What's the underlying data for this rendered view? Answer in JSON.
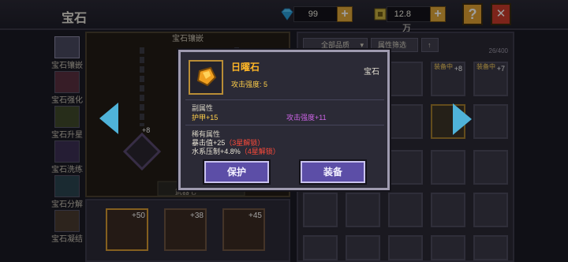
{
  "header": {
    "title": "宝石",
    "diamonds": "99",
    "gold": "12.8万",
    "help_label": "?",
    "close_label": "✕"
  },
  "sidenav": [
    {
      "label": "宝石镶嵌"
    },
    {
      "label": "宝石强化"
    },
    {
      "label": "宝石升星"
    },
    {
      "label": "宝石洗练"
    },
    {
      "label": "宝石分解"
    },
    {
      "label": "宝石凝结"
    }
  ],
  "left_panel": {
    "title": "宝石镶嵌",
    "bottom_label": "武器七",
    "slot_levels": [
      "+8",
      "+50",
      "+38",
      "+45"
    ]
  },
  "right_panel": {
    "filter_quality": "全部品质",
    "filter_attr": "属性筛选",
    "counter": "26/400",
    "equipped_tag": "装备中",
    "cell_levels": [
      "+8",
      "+7"
    ]
  },
  "popup": {
    "name": "日曜石",
    "type": "宝石",
    "attack": "攻击强度: 5",
    "sub_title": "副属性",
    "sub_attr_1": "护甲+15",
    "sub_attr_2": "攻击强度+11",
    "rare_title": "稀有属性",
    "rare_1": "暴击值+25",
    "rare_1_lock": "（3星解锁）",
    "rare_2": "水系压制+4.8%",
    "rare_2_lock": "（4星解锁）",
    "protect_label": "保护",
    "equip_label": "装备"
  },
  "colors": {
    "accent_gold": "#ffb627",
    "accent_purple": "#cc64e6",
    "button": "#5c4ea7",
    "arrow": "#4fb3d9"
  }
}
